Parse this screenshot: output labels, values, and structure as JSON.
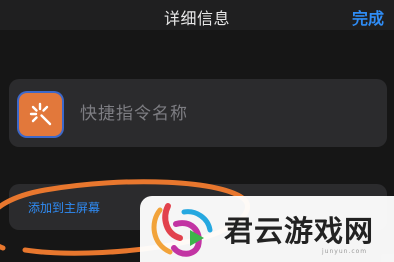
{
  "nav": {
    "title": "详细信息",
    "done_label": "完成"
  },
  "shortcut": {
    "name_placeholder": "快捷指令名称",
    "icon": "magic-sparkle-icon",
    "icon_color": "#E2783B"
  },
  "home_screen": {
    "label": "添加到主屏幕"
  },
  "annotation": {
    "shape": "hand-drawn-ellipse",
    "color": "#E8772E"
  },
  "watermark": {
    "text": "君云游戏网",
    "domain": "junyun.com"
  },
  "colors": {
    "background": "#161616",
    "card": "#2B2B2D",
    "accent": "#2F8CF5"
  }
}
